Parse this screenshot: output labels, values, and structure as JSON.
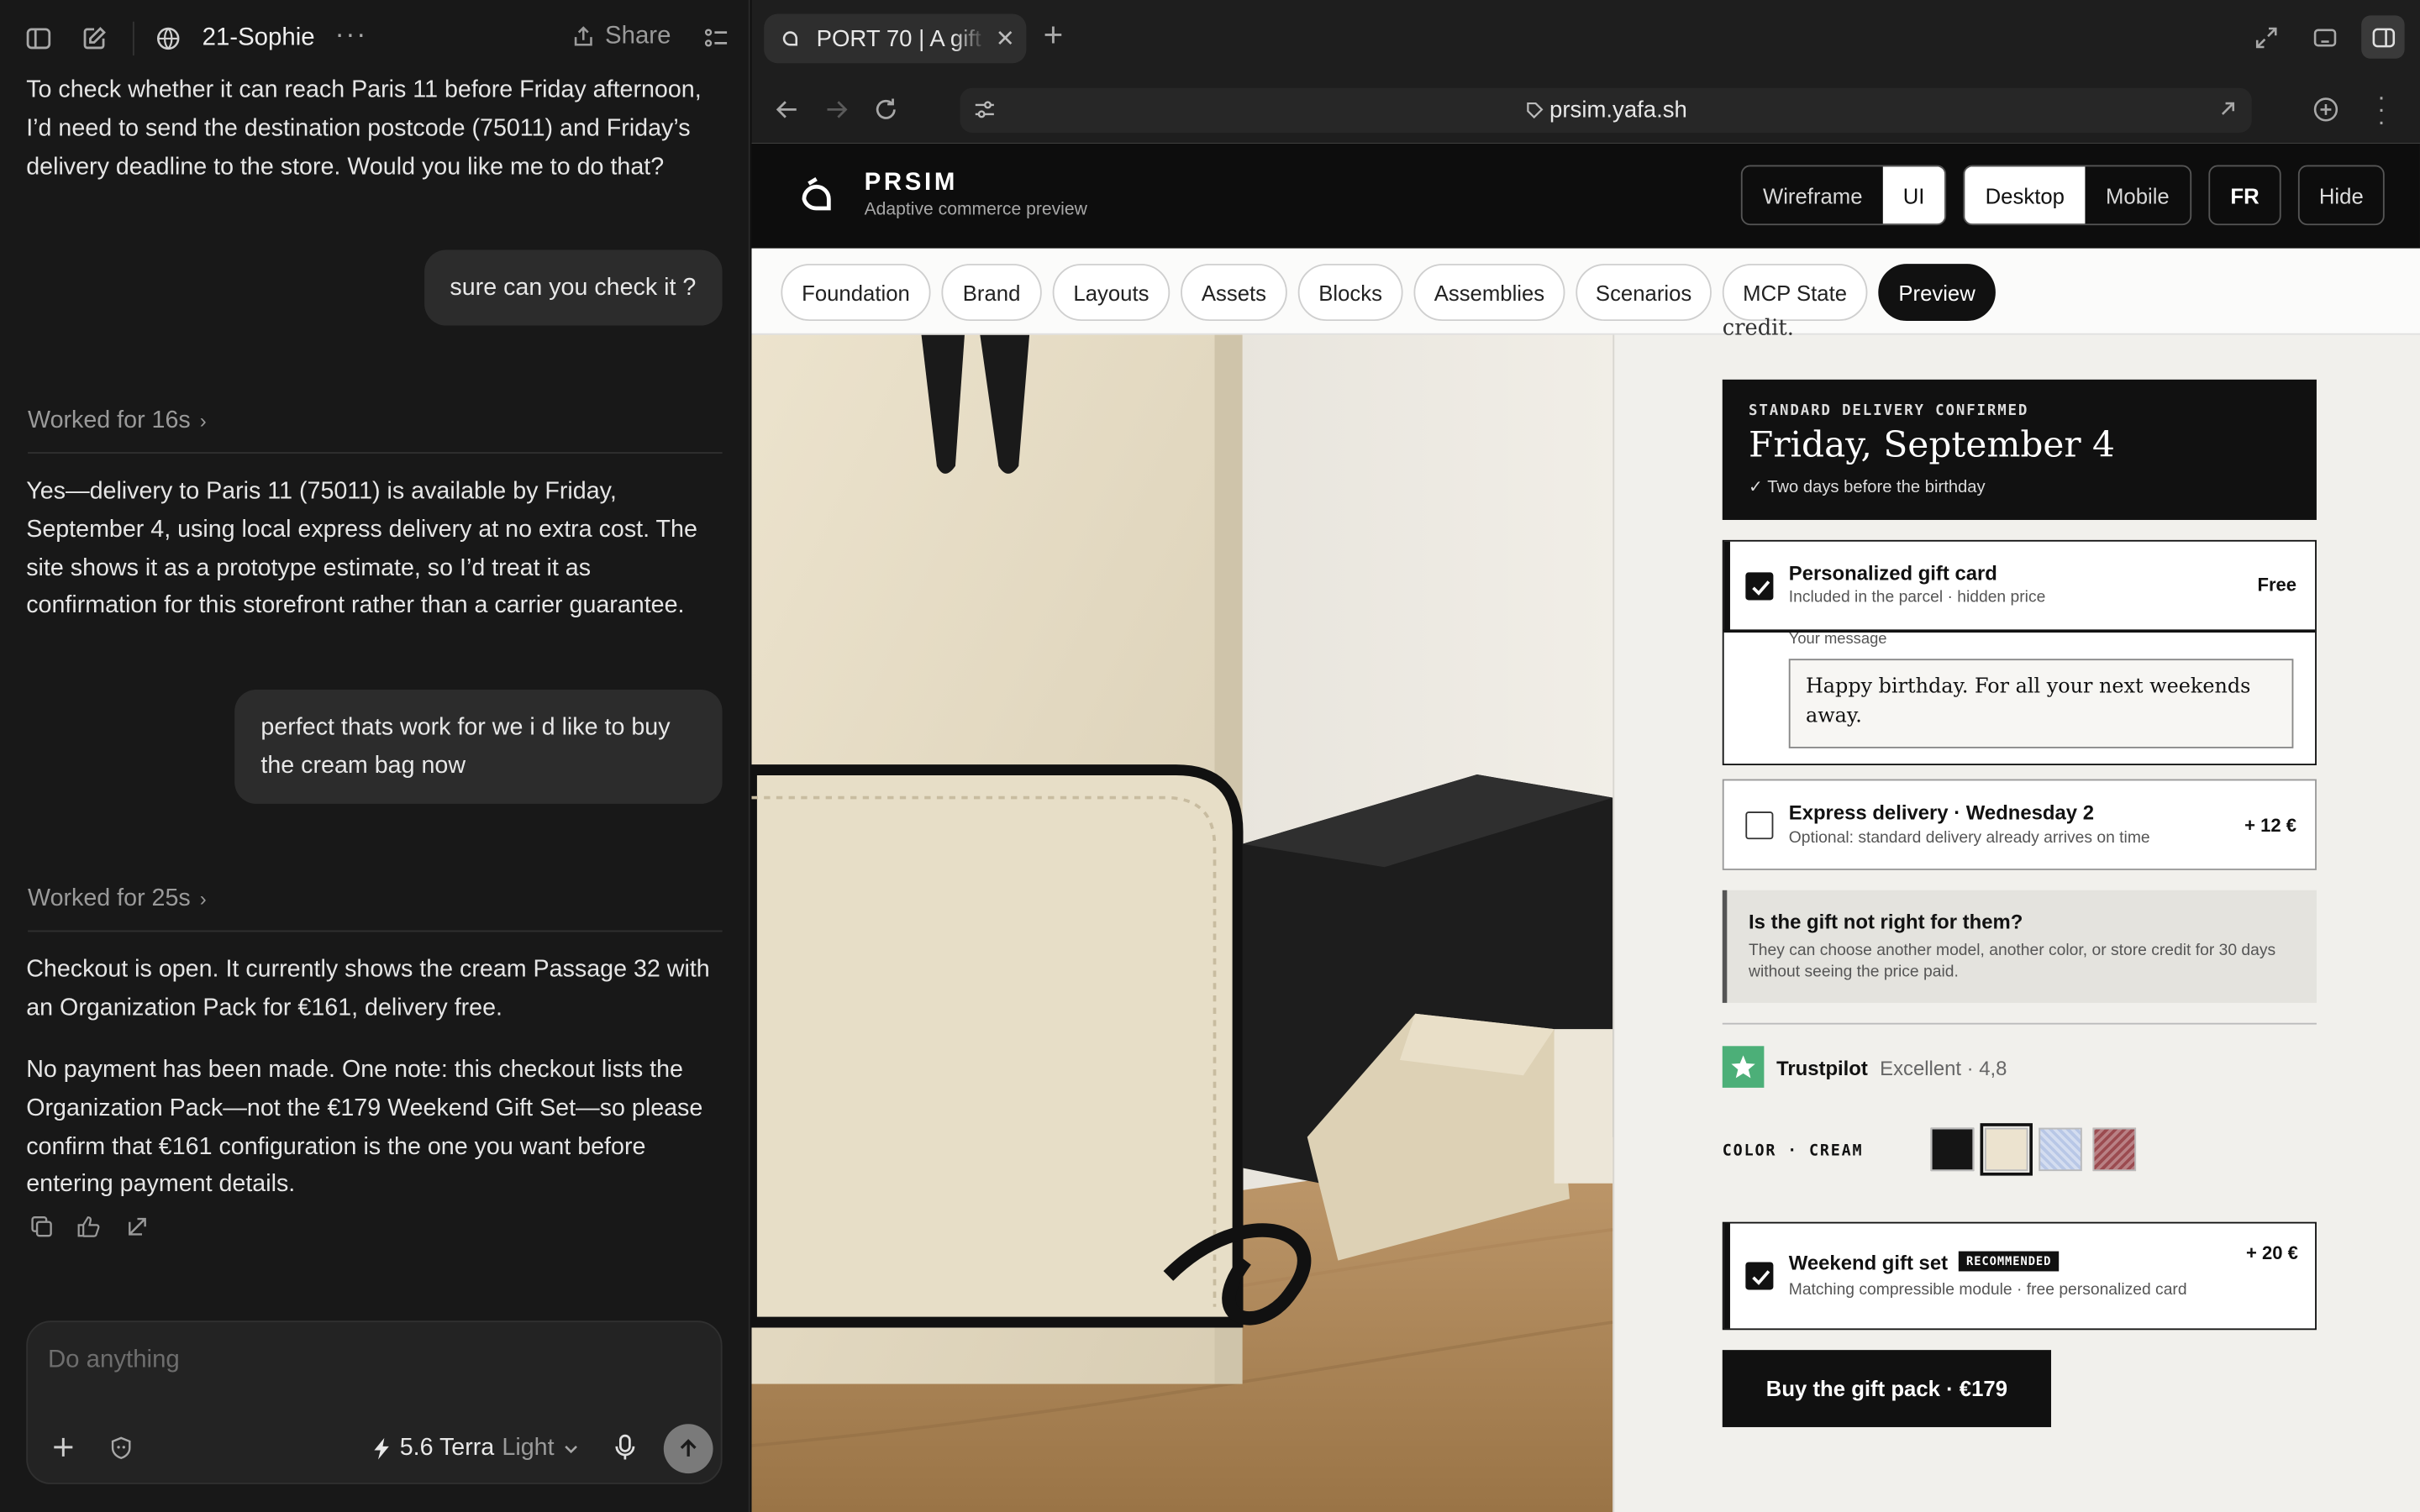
{
  "left": {
    "title": "21-Sophie",
    "share": "Share",
    "msg1": "To check whether it can reach Paris 11 before Friday afternoon, I’d need to send the destination postcode (75011) and Friday’s delivery deadline to the store. Would you like me to do that?",
    "user1": "sure can you check it ?",
    "worked1": "Worked for 16s",
    "msg2": "Yes—delivery to Paris 11 (75011) is available by Friday, September 4, using local express delivery at no extra cost. The site shows it as a prototype estimate, so I’d treat it as confirmation for this storefront rather than a carrier guarantee.",
    "user2": "perfect thats work for we i d like to buy the cream bag now",
    "worked2": "Worked for 25s",
    "msg3": "Checkout is open. It currently shows the cream Passage 32 with an Organization Pack for €161, delivery free.",
    "msg4": "No payment has been made. One note: this checkout lists the Organization Pack—not the €179 Weekend Gift Set—so please confirm that €161 configuration is the one you want before entering payment details.",
    "composer_placeholder": "Do anything",
    "model_name": "5.6 Terra",
    "model_mode": "Light"
  },
  "browser": {
    "tab_title": "PORT 70 | A gift",
    "url": "prsim.yafa.sh"
  },
  "page": {
    "brand": "PRSIM",
    "brand_sub": "Adaptive commerce preview",
    "seg1": [
      "Wireframe",
      "UI"
    ],
    "seg2": [
      "Desktop",
      "Mobile"
    ],
    "lang": "FR",
    "hide": "Hide",
    "nav": [
      "Foundation",
      "Brand",
      "Layouts",
      "Assets",
      "Blocks",
      "Assemblies",
      "Scenarios",
      "MCP State",
      "Preview"
    ],
    "cut_text": "credit.",
    "delivery_kicker": "STANDARD DELIVERY CONFIRMED",
    "delivery_date": "Friday, September 4",
    "delivery_note": "✓ Two days before the birthday",
    "giftcard_title": "Personalized gift card",
    "giftcard_sub": "Included in the parcel · hidden price",
    "giftcard_price": "Free",
    "message_label": "Your message",
    "message_value": "Happy birthday. For all your next weekends away.",
    "express_title": "Express delivery · Wednesday 2",
    "express_sub": "Optional: standard delivery already arrives on time",
    "express_price": "+ 12 €",
    "info_title": "Is the gift not right for them?",
    "info_body": "They can choose another model, another color, or store credit for 30 days without seeing the price paid.",
    "trust_name": "Trustpilot",
    "trust_rating": "Excellent · 4,8",
    "color_label": "COLOR · CREAM",
    "swatches": [
      "#151515",
      "#ece3cf",
      "#b8c7e6",
      "#9b4b50"
    ],
    "set_title": "Weekend gift set",
    "set_badge": "RECOMMENDED",
    "set_sub": "Matching compressible module · free personalized card",
    "set_price": "+ 20 €",
    "buy": "Buy the gift pack · €179"
  }
}
